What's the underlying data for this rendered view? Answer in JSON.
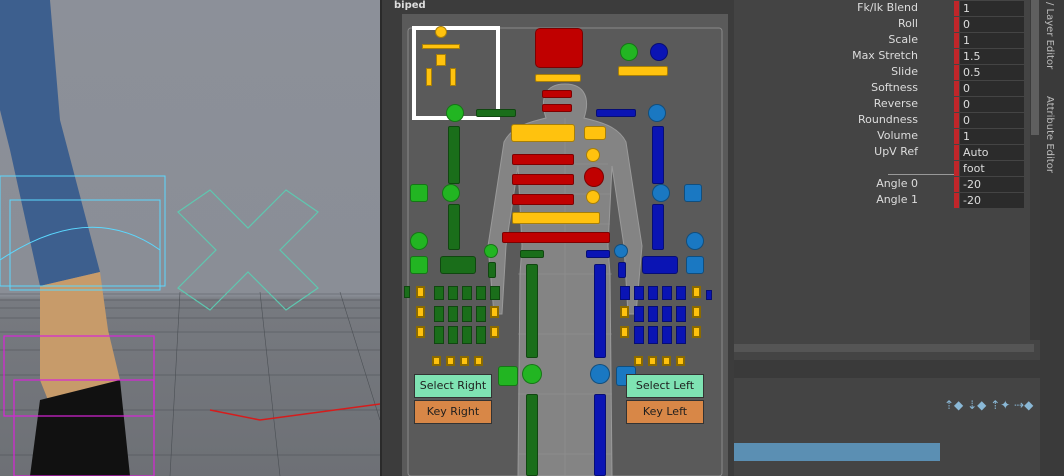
{
  "picker": {
    "title": "biped"
  },
  "buttons": {
    "select_right": "Select Right",
    "key_right": "Key Right",
    "select_left": "Select Left",
    "key_left": "Key Left"
  },
  "side_tabs": {
    "layer_editor": "/ Layer Editor",
    "attribute_editor": "Attribute Editor"
  },
  "attributes": [
    {
      "label": "Fk/Ik Blend",
      "value": "1",
      "flag": true
    },
    {
      "label": "Roll",
      "value": "0",
      "flag": true
    },
    {
      "label": "Scale",
      "value": "1",
      "flag": true
    },
    {
      "label": "Max Stretch",
      "value": "1.5",
      "flag": true
    },
    {
      "label": "Slide",
      "value": "0.5",
      "flag": true
    },
    {
      "label": "Softness",
      "value": "0",
      "flag": true
    },
    {
      "label": "Reverse",
      "value": "0",
      "flag": true
    },
    {
      "label": "Roundness",
      "value": "0",
      "flag": true
    },
    {
      "label": "Volume",
      "value": "1",
      "flag": true
    },
    {
      "label": "UpV Ref",
      "value": "Auto",
      "flag": true
    },
    {
      "label": "",
      "value": "foot",
      "flag": true
    },
    {
      "label": "Angle 0",
      "value": "-20",
      "flag": true
    },
    {
      "label": "Angle 1",
      "value": "-20",
      "flag": true
    }
  ],
  "colors": {
    "yellow": "#ffc20e",
    "red": "#c00000",
    "green": "#1a6e1a",
    "bright_green": "#22b522",
    "blue": "#0a14b4",
    "light_blue": "#1a78c2"
  }
}
